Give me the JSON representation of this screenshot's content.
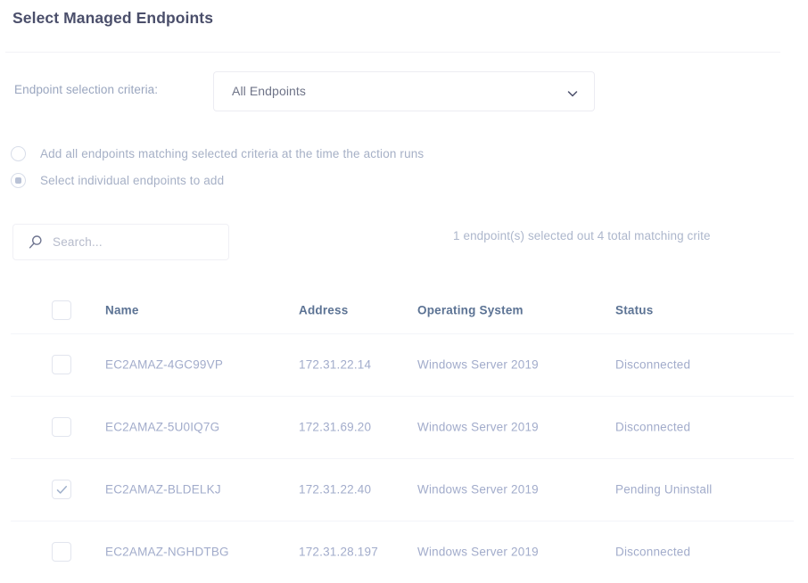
{
  "title": "Select Managed Endpoints",
  "criteria": {
    "label": "Endpoint selection criteria:",
    "selected": "All Endpoints",
    "caret_icon": "chevron-down-icon"
  },
  "radios": [
    {
      "label": "Add all endpoints matching selected criteria at the time the action runs",
      "checked": false
    },
    {
      "label": "Select individual endpoints to add",
      "checked": true
    }
  ],
  "search": {
    "icon": "search-icon",
    "placeholder": "Search...",
    "value": ""
  },
  "selection_count": "1 endpoint(s) selected out 4 total matching crite",
  "table": {
    "columns": [
      "Name",
      "Address",
      "Operating System",
      "Status"
    ],
    "header_checkbox_checked": false,
    "rows": [
      {
        "checked": false,
        "name": "EC2AMAZ-4GC99VP",
        "address": "172.31.22.14",
        "os": "Windows Server 2019",
        "status": "Disconnected"
      },
      {
        "checked": false,
        "name": "EC2AMAZ-5U0IQ7G",
        "address": "172.31.69.20",
        "os": "Windows Server 2019",
        "status": "Disconnected"
      },
      {
        "checked": true,
        "name": "EC2AMAZ-BLDELKJ",
        "address": "172.31.22.40",
        "os": "Windows Server 2019",
        "status": "Pending Uninstall"
      },
      {
        "checked": false,
        "name": "EC2AMAZ-NGHDTBG",
        "address": "172.31.28.197",
        "os": "Windows Server 2019",
        "status": "Disconnected"
      }
    ]
  },
  "colors": {
    "title": "#4b4f6b",
    "muted_text": "#a6b0c6",
    "row_text": "#a2accb",
    "header_text": "#5c7394",
    "border": "#f0f0f5"
  }
}
